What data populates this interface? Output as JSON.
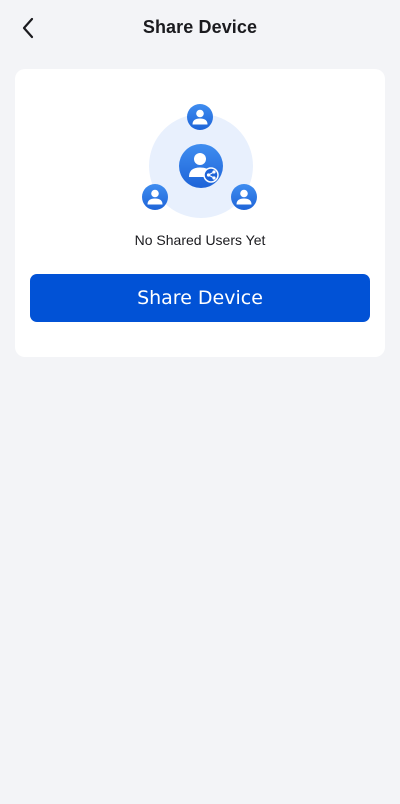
{
  "header": {
    "back_icon": "chevron-left-icon",
    "title": "Share Device"
  },
  "empty_state": {
    "icon": "share-users-illustration",
    "message": "No Shared Users Yet"
  },
  "actions": {
    "share_label": "Share Device"
  },
  "colors": {
    "background": "#f3f4f7",
    "card": "#ffffff",
    "primary": "#0152d6",
    "icon_blue": "#2f7be8",
    "halo": "#e8f0fd"
  }
}
